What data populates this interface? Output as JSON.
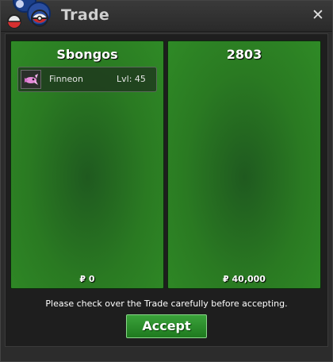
{
  "window": {
    "title": "Trade",
    "close_glyph": "✕",
    "icons": {
      "logo": "pokeball-logo",
      "close": "close-icon"
    },
    "colors": {
      "panel_green": "#2a7a22",
      "accept_green": "#2f8f2f",
      "background": "#1e1e1e"
    }
  },
  "trade": {
    "left": {
      "name": "Sbongos",
      "pokemon": [
        {
          "name": "Finneon",
          "level": "Lvl: 45",
          "icon": "finneon-sprite-icon"
        }
      ],
      "money": "₽ 0"
    },
    "right": {
      "name": "2803",
      "pokemon": [],
      "money": "₽ 40,000"
    },
    "notice": "Please check over the Trade carefully before accepting.",
    "accept_label": "Accept"
  }
}
